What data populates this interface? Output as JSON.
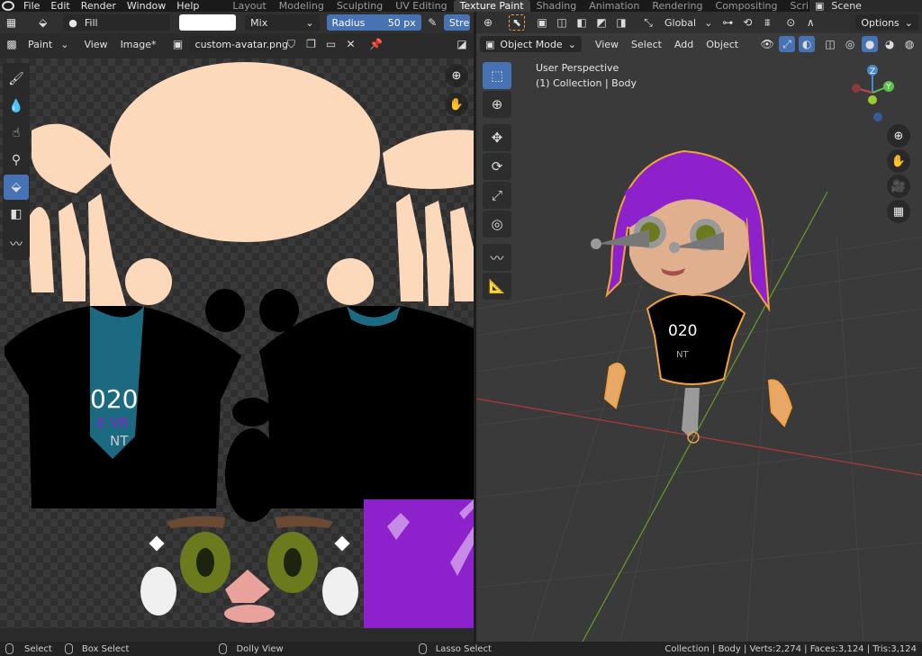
{
  "menu": {
    "items": [
      "File",
      "Edit",
      "Render",
      "Window",
      "Help"
    ]
  },
  "workspaces": [
    "Layout",
    "Modeling",
    "Sculpting",
    "UV Editing",
    "Texture Paint",
    "Shading",
    "Animation",
    "Rendering",
    "Compositing",
    "Scripting"
  ],
  "active_workspace": "Texture Paint",
  "scene": {
    "label": "Scene"
  },
  "paint_header": {
    "brush": "Fill",
    "blend": "Mix",
    "radius_label": "Radius",
    "radius_value": "50 px",
    "strength_label": "Stre"
  },
  "image_header": {
    "mode": "Paint",
    "view": "View",
    "image_menu": "Image*",
    "image_name": "custom-avatar.png"
  },
  "viewport_header": {
    "orientation": "Global",
    "options": "Options",
    "mode": "Object Mode",
    "view": "View",
    "select": "Select",
    "add": "Add",
    "object": "Object"
  },
  "viewport_overlay": {
    "perspective": "User Perspective",
    "collection": "(1) Collection | Body"
  },
  "uv_shirt_text": {
    "year": "020",
    "line2": "E VR",
    "line3": "NT"
  },
  "model_shirt_text": {
    "year": "020",
    "line3": "NT"
  },
  "status": {
    "select": "Select",
    "box_select": "Box Select",
    "dolly": "Dolly View",
    "lasso": "Lasso Select",
    "stats": "Collection | Body | Verts:2,274 | Faces:3,124 | Tris:3,124"
  },
  "colors": {
    "skin": "#fdd9bb",
    "shirt": "#000000",
    "collar": "#1b6a82",
    "hair": "#8d22cc",
    "eye_green": "#6b7a1d",
    "accent": "#4772b3",
    "outline": "#f2a23c"
  }
}
